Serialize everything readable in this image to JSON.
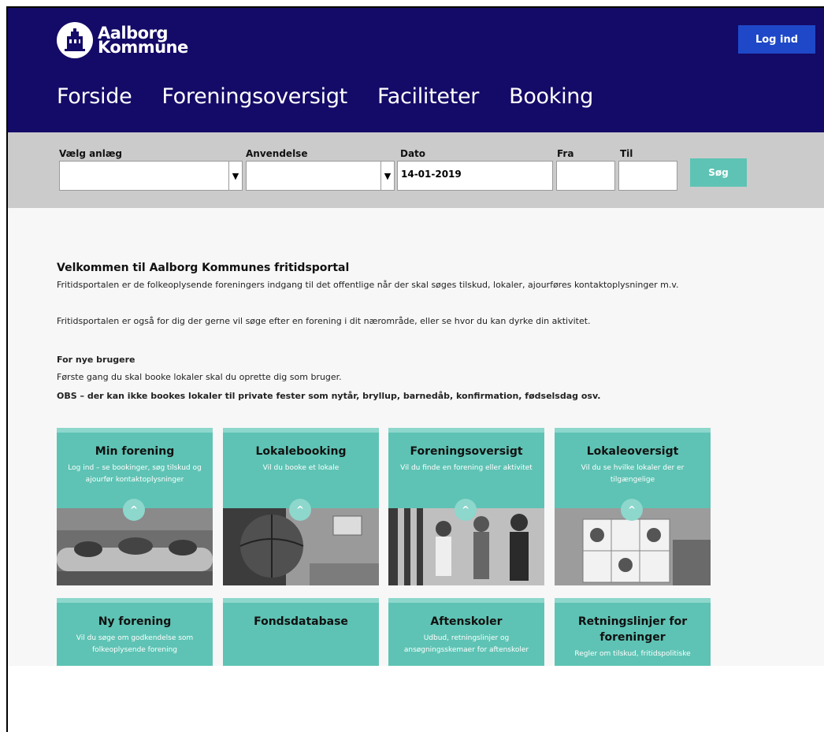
{
  "header": {
    "logo_line1": "Aalborg",
    "logo_line2": "Kommune",
    "login_label": "Log ind",
    "nav": [
      "Forside",
      "Foreningsoversigt",
      "Faciliteter",
      "Booking"
    ]
  },
  "search": {
    "facility_label": "Vælg anlæg",
    "usage_label": "Anvendelse",
    "date_label": "Dato",
    "date_value": "14-01-2019",
    "from_label": "Fra",
    "to_label": "Til",
    "search_label": "Søg"
  },
  "intro": {
    "title": "Velkommen til Aalborg Kommunes fritidsportal",
    "p1": "Fritidsportalen er de folkeoplysende foreningers indgang til det offentlige når der skal søges tilskud, lokaler, ajourføres kontaktoplysninger m.v.",
    "p2": "Fritidsportalen er også for dig der gerne vil søge efter en forening i dit nærområde, eller se hvor du kan dyrke din aktivitet.",
    "new_users_heading": "For nye brugere",
    "new_users_text": "Første gang du skal booke lokaler skal du oprette dig som bruger.",
    "obs": "OBS – der kan ikke bookes lokaler til private fester som nytår, bryllup, barnedåb, konfirmation, fødselsdag osv."
  },
  "tiles_row1": [
    {
      "title": "Min forening",
      "sub": "Log ind – se bookinger, søg tilskud og ajourfør kontaktoplysninger"
    },
    {
      "title": "Lokalebooking",
      "sub": "Vil du booke et lokale"
    },
    {
      "title": "Foreningsoversigt",
      "sub": "Vil du finde en forening eller aktivitet"
    },
    {
      "title": "Lokaleoversigt",
      "sub": "Vil du se hvilke lokaler der er tilgængelige"
    }
  ],
  "tiles_row2": [
    {
      "title": "Ny forening",
      "sub": "Vil du søge om godkendelse som folkeoplysende forening"
    },
    {
      "title": "Fondsdatabase",
      "sub": ""
    },
    {
      "title": "Aftenskoler",
      "sub": "Udbud, retningslinjer og ansøgningsskemaer for aftenskoler"
    },
    {
      "title": "Retningslinjer for foreninger",
      "sub": "Regler om tilskud, fritidspolitiske"
    }
  ],
  "colors": {
    "header": "#140a67",
    "login": "#1e48c8",
    "accent": "#5ec3b4"
  }
}
